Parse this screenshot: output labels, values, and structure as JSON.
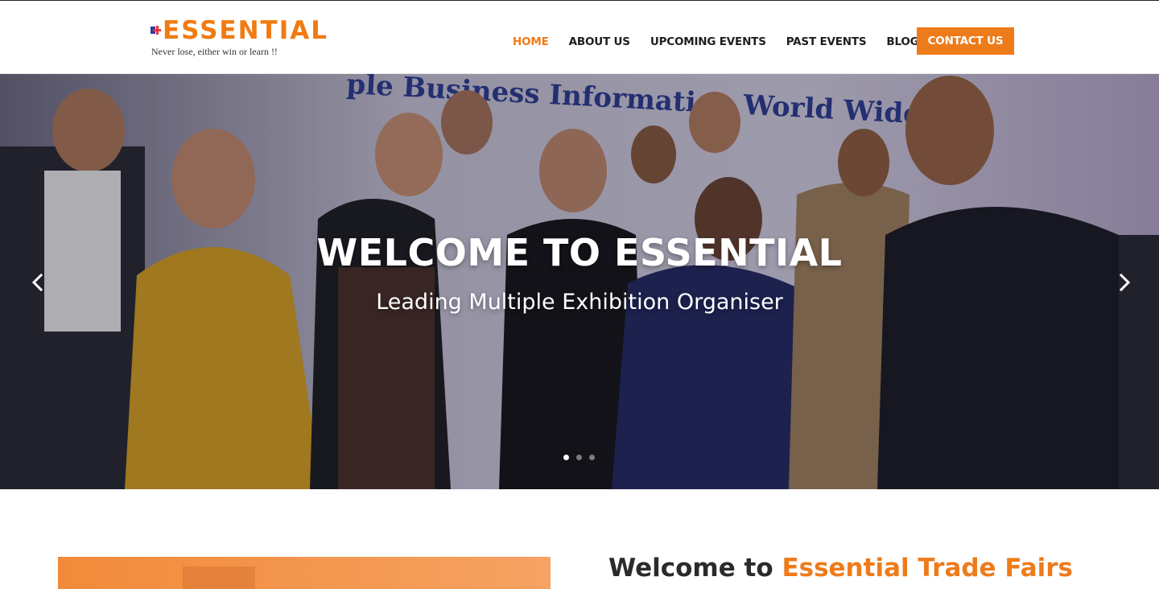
{
  "brand": {
    "name": "ESSENTIAL",
    "tagline": "Never lose, either win or learn !!",
    "accent_color": "#ee7b1a"
  },
  "nav": {
    "items": [
      {
        "label": "HOME",
        "active": true
      },
      {
        "label": "ABOUT US",
        "active": false
      },
      {
        "label": "UPCOMING EVENTS",
        "active": false
      },
      {
        "label": "PAST EVENTS",
        "active": false
      },
      {
        "label": "BLOG",
        "active": false
      }
    ],
    "contact_label": "CONTACT US"
  },
  "hero": {
    "backdrop_text": "ple Business Information World Wide",
    "title": "WELCOME TO ESSENTIAL",
    "subtitle": "Leading Multiple Exhibition Organiser",
    "prev_icon": "chevron-left-icon",
    "next_icon": "chevron-right-icon",
    "slides_count": 3,
    "active_slide": 1
  },
  "about": {
    "title_prefix": "Welcome to ",
    "title_accent": "Essential Trade Fairs"
  }
}
